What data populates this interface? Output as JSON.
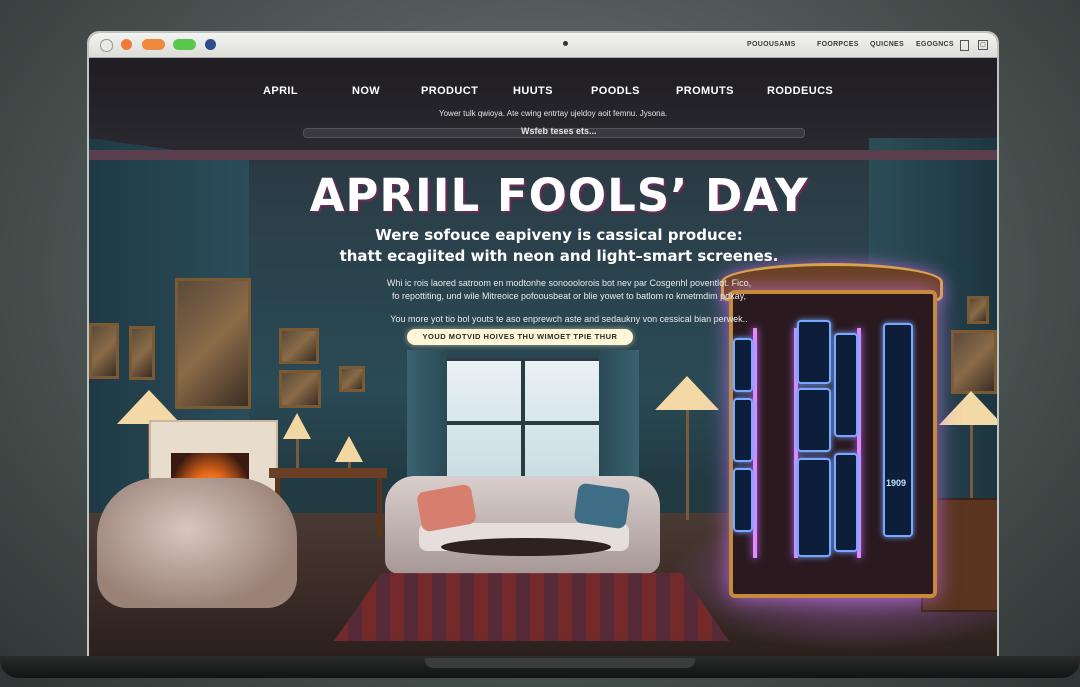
{
  "browser": {
    "links": [
      "POUOUSAMS",
      "FOORPCES",
      "QUICNES",
      "EGOGNCS"
    ]
  },
  "nav": [
    "APRIL",
    "NOW",
    "PRODUCT",
    "HUUTS",
    "POODLS",
    "PROMUTS",
    "RODDEUCS"
  ],
  "header": {
    "tagline": "Yower tulk qwioya. Ate cwing entrtay ujeldoy aoit femnu. Jysona.",
    "subline": "Wsfeb teses ets..."
  },
  "hero": {
    "title": "APRIIL FOOLS’ DAY",
    "subtitle_line1": "Were sofouce eapiveny is cassical produce:",
    "subtitle_line2": "thatt ecagiited with neon and light–smart screenes.",
    "body_line1": "Whi ic rois laored satroom en modtonhe sonooolorois bot nev par Cosgenhl poventlot. Fico,",
    "body_line2": "fo repottiting, und wile Mitreoice pofoousbeat or blie yowet to batlom ro kmetmdim pdkay,",
    "body_line3": "You more yot tio bol youts te aso enprewch aste and sedaukny von cessical bian perwek..",
    "cta": "YOUD MOTVID HOIVES THU WIMOET TPIE THUR"
  },
  "cabinet": {
    "screen_label": "1909"
  },
  "colors": {
    "neon": "#e08bff",
    "screen_glow": "#6ea2ff",
    "cta_bg": "#fff6d8"
  }
}
